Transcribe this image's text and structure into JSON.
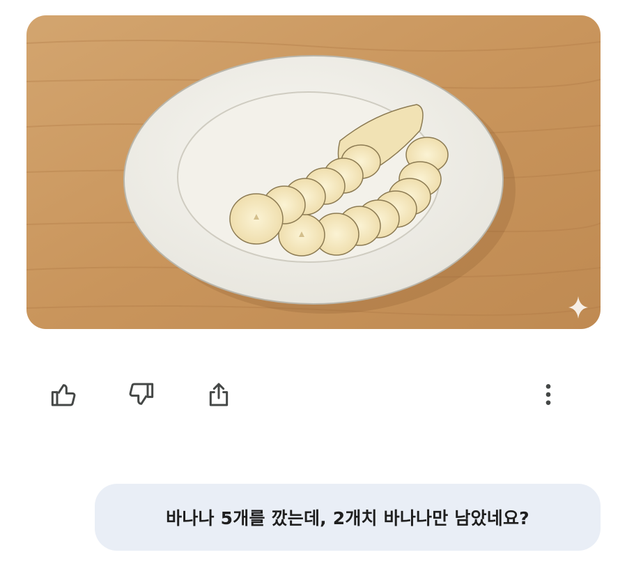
{
  "image": {
    "alt_icon": "sparkle-icon"
  },
  "actions": [
    {
      "name": "thumbs-up-button",
      "icon": "thumbs-up-icon"
    },
    {
      "name": "thumbs-down-button",
      "icon": "thumbs-down-icon"
    },
    {
      "name": "share-button",
      "icon": "share-icon"
    },
    {
      "name": "more-options-button",
      "icon": "more-vertical-icon"
    }
  ],
  "user_message": {
    "text": "바나나 5개를 깠는데, 2개치 바나나만 남았네요?"
  },
  "colors": {
    "bubble_bg": "#e9eef6",
    "icon": "#444746",
    "text": "#1f1f1f"
  }
}
